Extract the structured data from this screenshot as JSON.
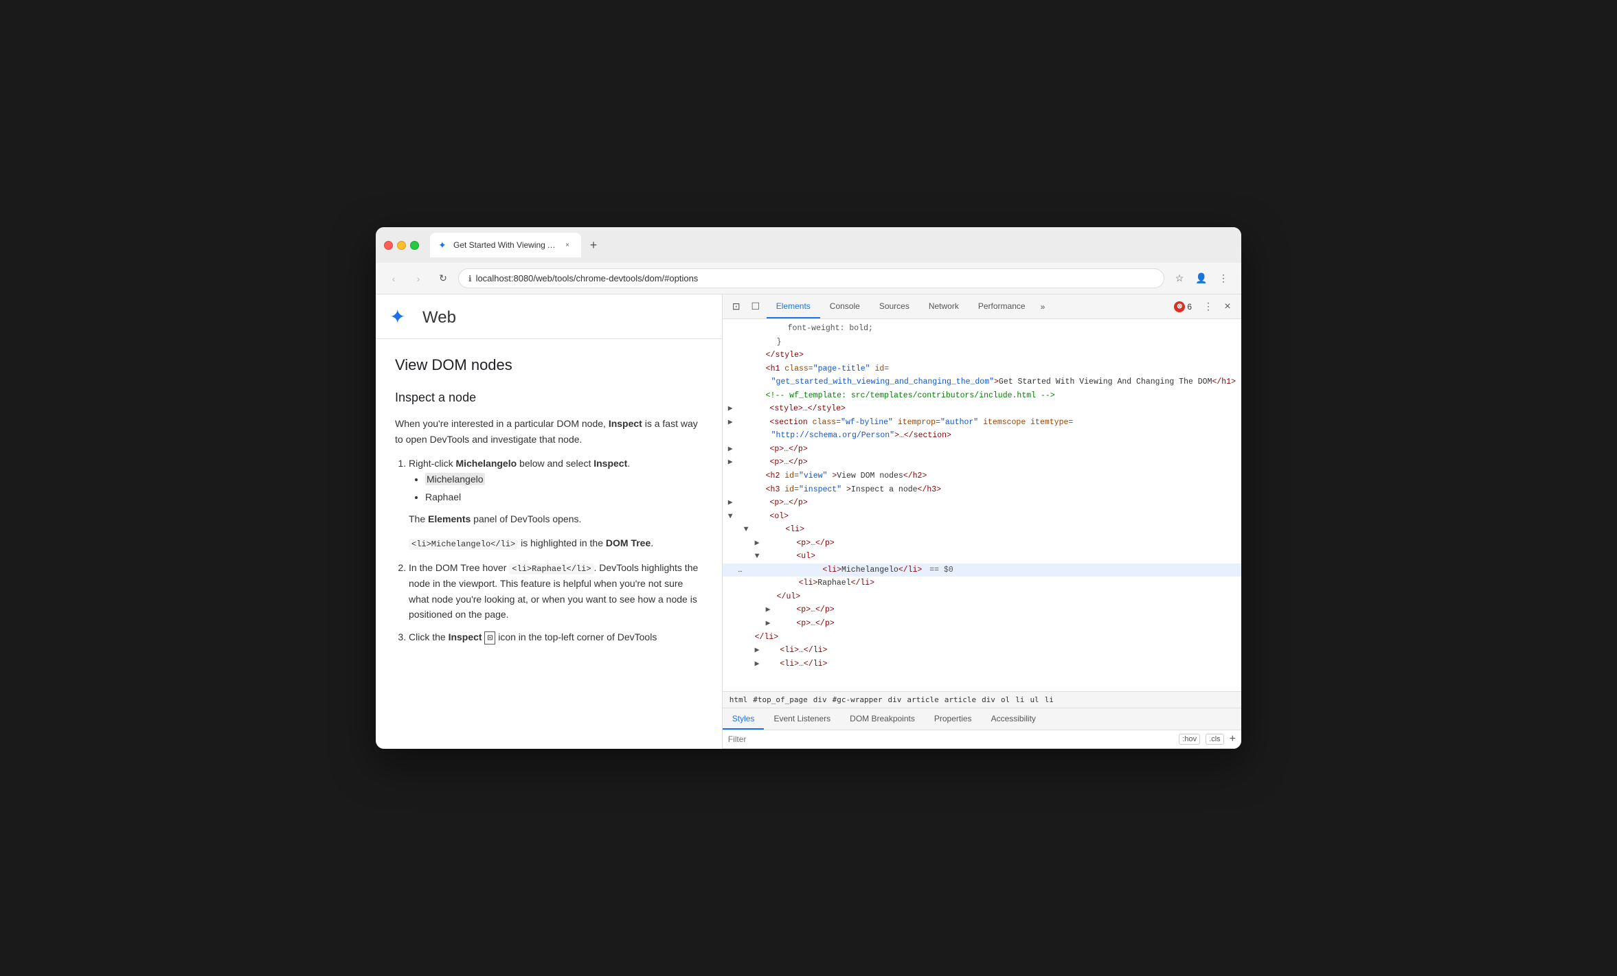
{
  "browser": {
    "traffic_lights": [
      "red",
      "yellow",
      "green"
    ],
    "tab": {
      "favicon": "✦",
      "title": "Get Started With Viewing And",
      "close_label": "×"
    },
    "new_tab_label": "+",
    "address": {
      "icon": "ℹ",
      "url": "localhost:8080/web/tools/chrome-devtools/dom/#options"
    },
    "nav": {
      "back": "‹",
      "forward": "›",
      "reload": "↻"
    },
    "actions": {
      "star": "☆",
      "account": "👤",
      "menu": "⋮"
    }
  },
  "webpage": {
    "logo_text": "✦",
    "site_title": "Web",
    "heading": "View DOM nodes",
    "subheading": "Inspect a node",
    "intro_p": "When you're interested in a particular DOM node, Inspect is a fast way to open DevTools and investigate that node.",
    "steps": [
      {
        "text_before": "Right-click ",
        "bold1": "Michelangelo",
        "text_mid": " below and select ",
        "bold2": "Inspect",
        "text_after": ".",
        "subitems": [
          "Michelangelo",
          "Raphael"
        ],
        "note": "The ",
        "note_bold": "Elements",
        "note_after": " panel of DevTools opens.",
        "code_line": "<li>Michelangelo</li>",
        "code_note_before": " is highlighted in the ",
        "code_note_bold": "DOM Tree",
        "code_note_after": "."
      },
      {
        "text_before": "In the DOM Tree hover ",
        "code": "<li>Raphael</li>",
        "text_after": ". DevTools highlights the node in the viewport. This feature is helpful when you're not sure what node you're looking at, or when you want to see how a node is positioned on the page."
      },
      {
        "text_before": "Click the ",
        "bold": "Inspect",
        "icon": "⊡",
        "text_after": " icon in the top-left corner of DevTools"
      }
    ]
  },
  "devtools": {
    "toolbar_icons": [
      "⊡",
      "☐"
    ],
    "tabs": [
      "Elements",
      "Console",
      "Sources",
      "Network",
      "Performance"
    ],
    "tab_more": "»",
    "active_tab": "Elements",
    "error_badge": {
      "icon": "⊗",
      "count": "6"
    },
    "menu_btn": "⋮",
    "close_btn": "×",
    "dom_tree": [
      {
        "indent": 12,
        "type": "css",
        "content": "font-weight: bold;"
      },
      {
        "indent": 10,
        "type": "text",
        "content": "}"
      },
      {
        "indent": 8,
        "type": "tag",
        "content": "</style>"
      },
      {
        "indent": 8,
        "type": "opentag",
        "tag": "h1",
        "attrs": [
          {
            "name": "class",
            "value": "page-title"
          },
          {
            "name": "id",
            "value": ""
          }
        ],
        "attr_value2": "get_started_with_viewing_and_changing_the_dom",
        "text": "Get Started With Viewing And Changing The DOM</h1>"
      },
      {
        "indent": 8,
        "type": "comment",
        "content": "<!-- wf_template: src/templates/contributors/include.html -->"
      },
      {
        "indent": 8,
        "type": "collapsed",
        "content": "<style>…</style>"
      },
      {
        "indent": 8,
        "type": "opentag_attrs",
        "tag": "section",
        "attrs": "class=\"wf-byline\" itemprop=\"author\" itemscope itemtype=",
        "attr_value": "\"http://schema.org/Person\"",
        "text": ">…</section>"
      },
      {
        "indent": 8,
        "type": "collapsed",
        "content": "<p>…</p>"
      },
      {
        "indent": 8,
        "type": "collapsed",
        "content": "<p>…</p>"
      },
      {
        "indent": 8,
        "type": "tag_text",
        "tag": "h2",
        "attr": "id",
        "attrval": "view",
        "text": "View DOM nodes</h2>"
      },
      {
        "indent": 8,
        "type": "tag_text",
        "tag": "h3",
        "attr": "id",
        "attrval": "inspect",
        "text": "Inspect a node</h3>"
      },
      {
        "indent": 8,
        "type": "collapsed",
        "content": "<p>…</p>"
      },
      {
        "indent": 8,
        "type": "open_arrow",
        "tag": "ol"
      },
      {
        "indent": 10,
        "type": "open_arrow",
        "tag": "li"
      },
      {
        "indent": 12,
        "type": "collapsed",
        "content": "<p>…</p>"
      },
      {
        "indent": 12,
        "type": "open_arrow",
        "tag": "ul"
      },
      {
        "indent": 14,
        "type": "selected",
        "content": "<li>Michelangelo</li> == $0"
      },
      {
        "indent": 14,
        "type": "normal",
        "content": "<li>Raphael</li>"
      },
      {
        "indent": 12,
        "type": "close",
        "content": "</ul>"
      },
      {
        "indent": 12,
        "type": "collapsed",
        "content": "<p>…</p>"
      },
      {
        "indent": 12,
        "type": "collapsed",
        "content": "<p>…</p>"
      },
      {
        "indent": 10,
        "type": "close",
        "content": "</li>"
      },
      {
        "indent": 10,
        "type": "collapsed",
        "content": "<li>…</li>"
      },
      {
        "indent": 10,
        "type": "collapsed_partial",
        "content": "<li>…</li>"
      }
    ],
    "breadcrumb": [
      "html",
      "#top_of_page",
      "div",
      "#gc-wrapper",
      "div",
      "article",
      "article",
      "div",
      "ol",
      "li",
      "ul",
      "li"
    ],
    "bottom_tabs": [
      "Styles",
      "Event Listeners",
      "DOM Breakpoints",
      "Properties",
      "Accessibility"
    ],
    "active_bottom_tab": "Styles",
    "filter": {
      "placeholder": "Filter",
      "hov_badge": ":hov",
      "cls_badge": ".cls",
      "plus": "+"
    }
  }
}
